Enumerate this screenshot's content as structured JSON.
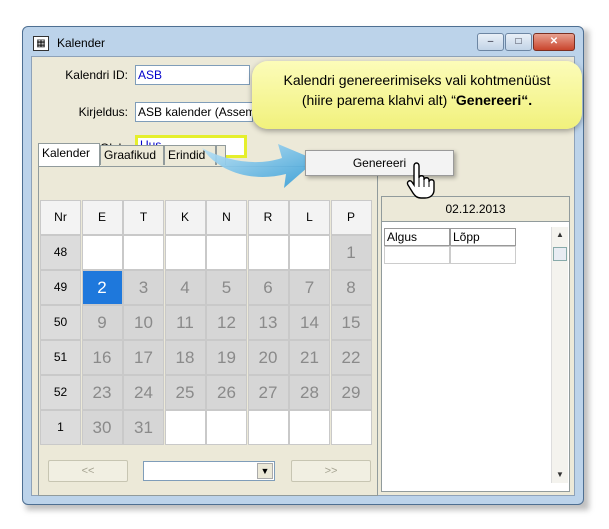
{
  "window": {
    "title": "Kalender",
    "controls": {
      "minimize": "–",
      "maximize": "□",
      "close": "✕"
    }
  },
  "form": {
    "id_label": "Kalendri ID:",
    "id_value": "ASB",
    "desc_label": "Kirjeldus:",
    "desc_value": "ASB kalender (Assemb",
    "status_label": "Olek:",
    "status_value": "Uus"
  },
  "tabs": [
    "Kalender",
    "Graafikud",
    "Erindid"
  ],
  "calendar": {
    "headers": [
      "Nr",
      "E",
      "T",
      "K",
      "N",
      "R",
      "L",
      "P"
    ],
    "rows": [
      {
        "week": "48",
        "days": [
          "",
          "",
          "",
          "",
          "",
          "",
          "1"
        ]
      },
      {
        "week": "49",
        "days": [
          "2",
          "3",
          "4",
          "5",
          "6",
          "7",
          "8"
        ]
      },
      {
        "week": "50",
        "days": [
          "9",
          "10",
          "11",
          "12",
          "13",
          "14",
          "15"
        ]
      },
      {
        "week": "51",
        "days": [
          "16",
          "17",
          "18",
          "19",
          "20",
          "21",
          "22"
        ]
      },
      {
        "week": "52",
        "days": [
          "23",
          "24",
          "25",
          "26",
          "27",
          "28",
          "29"
        ]
      },
      {
        "week": "1",
        "days": [
          "30",
          "31",
          "",
          "",
          "",
          "",
          ""
        ]
      }
    ],
    "selected_day": "2",
    "prev_label": "<<",
    "next_label": ">>",
    "month_combo_value": ""
  },
  "detail": {
    "date": "02.12.2013",
    "col_start": "Algus",
    "col_end": "Lõpp"
  },
  "callout": {
    "text_main": "Kalendri genereerimiseks vali kohtmenüüst",
    "text_sub": "(hiire parema klahvi alt) “",
    "text_bold": "Genereeri“."
  },
  "context_menu": {
    "item": "Genereeri"
  },
  "colors": {
    "accent": "#1e78dc",
    "callout": "#f6f68f",
    "highlight": "#e5ef2c"
  }
}
